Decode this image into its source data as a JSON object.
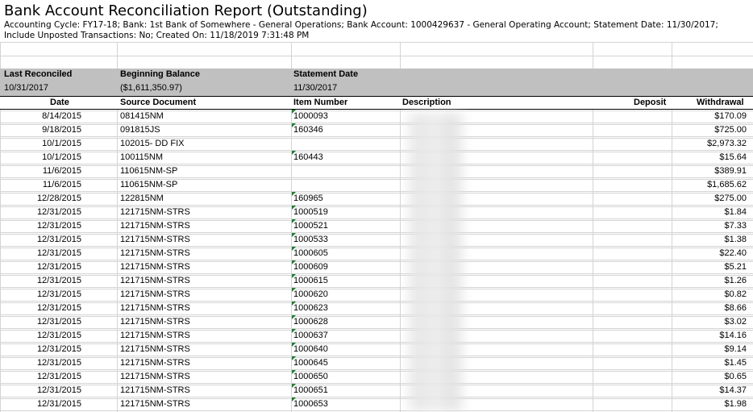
{
  "report": {
    "title": "Bank Account Reconciliation Report (Outstanding)",
    "subtitle": "Accounting Cycle: FY17-18; Bank: 1st Bank of Somewhere - General Operations; Bank Account: 1000429637 - General Operating Account; Statement Date: 11/30/2017; Include Unposted Transactions: No; Created On: 11/18/2019 7:31:48 PM"
  },
  "summary": {
    "last_reconciled_label": "Last Reconciled",
    "last_reconciled_value": "10/31/2017",
    "beginning_balance_label": "Beginning Balance",
    "beginning_balance_value": "($1,611,350.97)",
    "statement_date_label": "Statement Date",
    "statement_date_value": "11/30/2017"
  },
  "columns": {
    "date": "Date",
    "source": "Source Document",
    "item": "Item Number",
    "description": "Description",
    "deposit": "Deposit",
    "withdrawal": "Withdrawal"
  },
  "rows": [
    {
      "date": "8/14/2015",
      "source": "081415NM",
      "item": "1000093",
      "withdrawal": "$170.09"
    },
    {
      "date": "9/18/2015",
      "source": "091815JS",
      "item": "160346",
      "withdrawal": "$725.00"
    },
    {
      "date": "10/1/2015",
      "source": "102015- DD FIX",
      "item": "",
      "withdrawal": "$2,973.32"
    },
    {
      "date": "10/1/2015",
      "source": "100115NM",
      "item": "160443",
      "withdrawal": "$15.64"
    },
    {
      "date": "11/6/2015",
      "source": "110615NM-SP",
      "item": "",
      "withdrawal": "$389.91"
    },
    {
      "date": "11/6/2015",
      "source": "110615NM-SP",
      "item": "",
      "withdrawal": "$1,685.62"
    },
    {
      "date": "12/28/2015",
      "source": "122815NM",
      "item": "160965",
      "withdrawal": "$275.00"
    },
    {
      "date": "12/31/2015",
      "source": "121715NM-STRS",
      "item": "1000519",
      "withdrawal": "$1.84"
    },
    {
      "date": "12/31/2015",
      "source": "121715NM-STRS",
      "item": "1000521",
      "withdrawal": "$7.33"
    },
    {
      "date": "12/31/2015",
      "source": "121715NM-STRS",
      "item": "1000533",
      "withdrawal": "$1.38"
    },
    {
      "date": "12/31/2015",
      "source": "121715NM-STRS",
      "item": "1000605",
      "withdrawal": "$22.40"
    },
    {
      "date": "12/31/2015",
      "source": "121715NM-STRS",
      "item": "1000609",
      "withdrawal": "$5.21"
    },
    {
      "date": "12/31/2015",
      "source": "121715NM-STRS",
      "item": "1000615",
      "withdrawal": "$1.26"
    },
    {
      "date": "12/31/2015",
      "source": "121715NM-STRS",
      "item": "1000620",
      "withdrawal": "$0.82"
    },
    {
      "date": "12/31/2015",
      "source": "121715NM-STRS",
      "item": "1000623",
      "withdrawal": "$8.66"
    },
    {
      "date": "12/31/2015",
      "source": "121715NM-STRS",
      "item": "1000628",
      "withdrawal": "$3.02"
    },
    {
      "date": "12/31/2015",
      "source": "121715NM-STRS",
      "item": "1000637",
      "withdrawal": "$14.16"
    },
    {
      "date": "12/31/2015",
      "source": "121715NM-STRS",
      "item": "1000640",
      "withdrawal": "$9.14"
    },
    {
      "date": "12/31/2015",
      "source": "121715NM-STRS",
      "item": "1000645",
      "withdrawal": "$1.45"
    },
    {
      "date": "12/31/2015",
      "source": "121715NM-STRS",
      "item": "1000650",
      "withdrawal": "$0.65"
    },
    {
      "date": "12/31/2015",
      "source": "121715NM-STRS",
      "item": "1000651",
      "withdrawal": "$14.37"
    },
    {
      "date": "12/31/2015",
      "source": "121715NM-STRS",
      "item": "1000653",
      "withdrawal": "$1.98"
    }
  ]
}
